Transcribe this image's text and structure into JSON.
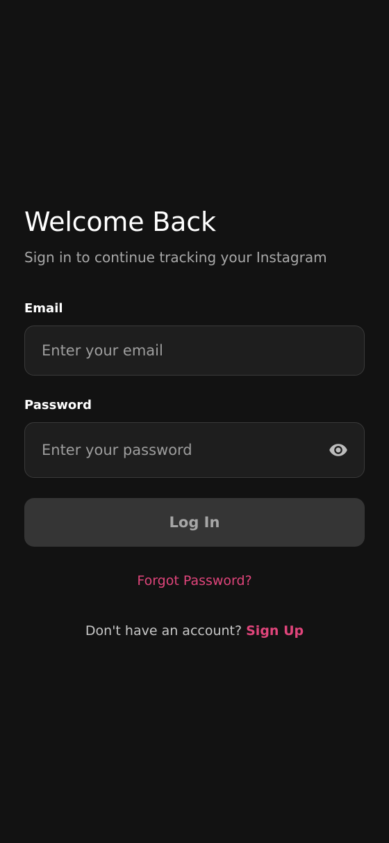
{
  "header": {
    "title": "Welcome Back",
    "subtitle": "Sign in to continue tracking your Instagram"
  },
  "email": {
    "label": "Email",
    "value": "",
    "placeholder": "Enter your email"
  },
  "password": {
    "label": "Password",
    "value": "",
    "placeholder": "Enter your password",
    "toggle_icon": "eye-icon"
  },
  "actions": {
    "login_label": "Log In",
    "forgot_label": "Forgot Password?"
  },
  "signup": {
    "prompt": "Don't have an account?",
    "link_label": "Sign Up"
  },
  "colors": {
    "background": "#121212",
    "accent": "#e0457b",
    "field_bg": "#1e1e1e",
    "button_bg": "#353535"
  }
}
